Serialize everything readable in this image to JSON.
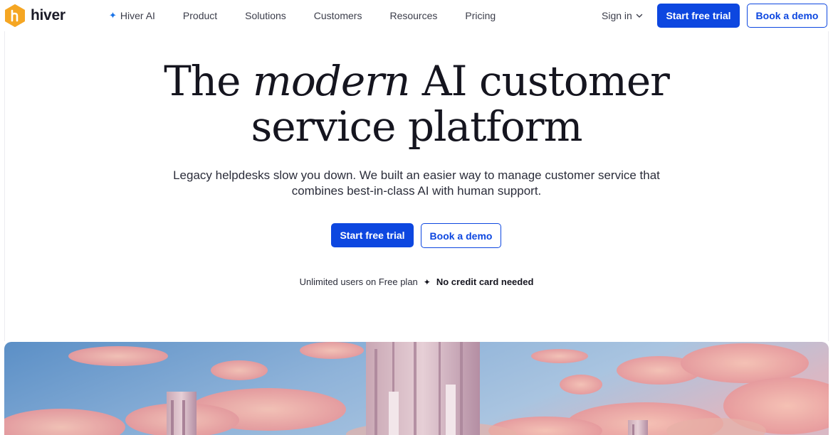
{
  "brand": {
    "name": "hiver",
    "logo_color": "#f5a623"
  },
  "nav": {
    "items": [
      {
        "label": "Hiver AI",
        "icon": "sparkle-icon"
      },
      {
        "label": "Product"
      },
      {
        "label": "Solutions"
      },
      {
        "label": "Customers"
      },
      {
        "label": "Resources"
      },
      {
        "label": "Pricing"
      }
    ],
    "sign_in": "Sign in",
    "start_trial": "Start free trial",
    "book_demo": "Book a demo"
  },
  "hero": {
    "title_pre": "The",
    "title_emph": "modern",
    "title_post": "AI customer",
    "title_line2": "service platform",
    "subtitle": "Legacy helpdesks slow you down. We built an easier way to manage customer service that combines best-in-class AI with human support.",
    "start_trial": "Start free trial",
    "book_demo": "Book a demo",
    "note_plain": "Unlimited users on Free plan",
    "note_bold": "No credit card needed"
  },
  "colors": {
    "accent": "#0d47e0",
    "text": "#15151f"
  }
}
